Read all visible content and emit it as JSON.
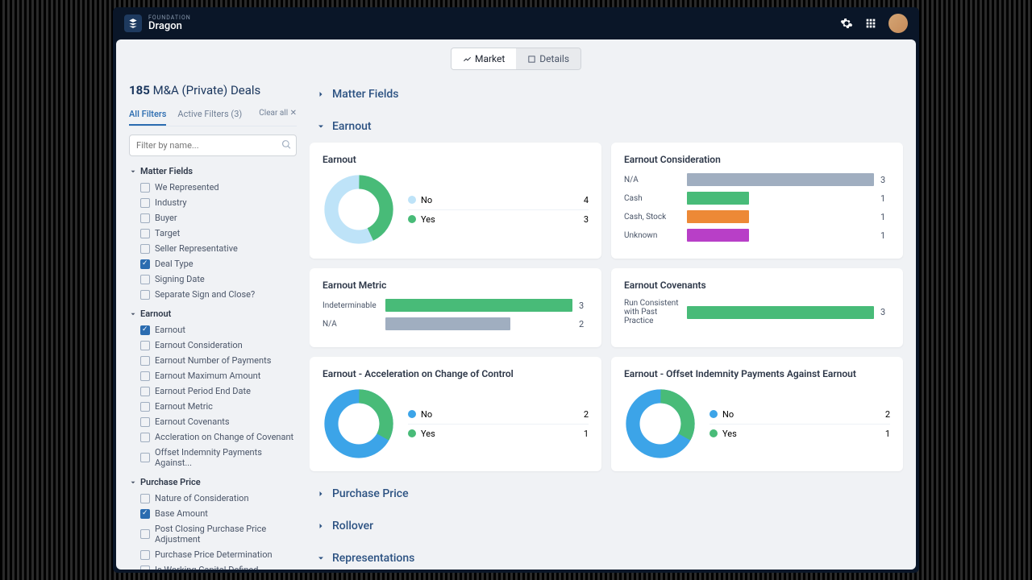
{
  "brand": {
    "sub": "FOUNDATION",
    "main": "Dragon"
  },
  "toggle": {
    "market": "Market",
    "details": "Details"
  },
  "sidebar": {
    "count": "185",
    "title": "M&A (Private) Deals",
    "tabs": {
      "all": "All Filters",
      "active": "Active Filters (3)",
      "clear": "Clear all"
    },
    "search_placeholder": "Filter by name...",
    "groups": [
      {
        "title": "Matter Fields",
        "items": [
          {
            "label": "We Represented",
            "checked": false
          },
          {
            "label": "Industry",
            "checked": false
          },
          {
            "label": "Buyer",
            "checked": false
          },
          {
            "label": "Target",
            "checked": false
          },
          {
            "label": "Seller Representative",
            "checked": false
          },
          {
            "label": "Deal Type",
            "checked": true
          },
          {
            "label": "Signing Date",
            "checked": false
          },
          {
            "label": "Separate Sign and Close?",
            "checked": false
          }
        ]
      },
      {
        "title": "Earnout",
        "items": [
          {
            "label": "Earnout",
            "checked": true
          },
          {
            "label": "Earnout Consideration",
            "checked": false
          },
          {
            "label": "Earnout Number of Payments",
            "checked": false
          },
          {
            "label": "Earnout Maximum Amount",
            "checked": false
          },
          {
            "label": "Earnout Period End Date",
            "checked": false
          },
          {
            "label": "Earnout Metric",
            "checked": false
          },
          {
            "label": "Earnout Covenants",
            "checked": false
          },
          {
            "label": "Accleration on Change of Covenant",
            "checked": false
          },
          {
            "label": "Offset Indemnity Payments Against...",
            "checked": false
          }
        ]
      },
      {
        "title": "Purchase Price",
        "items": [
          {
            "label": "Nature of Consideration",
            "checked": false
          },
          {
            "label": "Base Amount",
            "checked": true
          },
          {
            "label": "Post Closing Purchase Price Adjustment",
            "checked": false
          },
          {
            "label": "Purchase Price Determination",
            "checked": false
          },
          {
            "label": "Is Working Capital Defined",
            "checked": false
          }
        ]
      }
    ]
  },
  "sections": {
    "matter": "Matter Fields",
    "earnout": "Earnout",
    "purchase": "Purchase Price",
    "rollover": "Rollover",
    "reps": "Representations"
  },
  "cards": {
    "earnout": {
      "title": "Earnout",
      "legend": [
        {
          "label": "No",
          "val": 4,
          "color": "#bee3f8"
        },
        {
          "label": "Yes",
          "val": 3,
          "color": "#48bb78"
        }
      ]
    },
    "consideration": {
      "title": "Earnout Consideration",
      "bars": [
        {
          "label": "N/A",
          "val": 3,
          "max": 3,
          "color": "#a0aec0"
        },
        {
          "label": "Cash",
          "val": 1,
          "max": 3,
          "color": "#48bb78"
        },
        {
          "label": "Cash, Stock",
          "val": 1,
          "max": 3,
          "color": "#ed8936"
        },
        {
          "label": "Unknown",
          "val": 1,
          "max": 3,
          "color": "#b83fc7"
        }
      ]
    },
    "metric": {
      "title": "Earnout Metric",
      "bars": [
        {
          "label": "Indeterminable",
          "val": 3,
          "max": 3,
          "color": "#48bb78"
        },
        {
          "label": "N/A",
          "val": 2,
          "max": 3,
          "color": "#a0aec0"
        }
      ]
    },
    "covenants": {
      "title": "Earnout Covenants",
      "bars": [
        {
          "label": "Run Consistent with Past Practice",
          "val": 3,
          "max": 3,
          "color": "#48bb78"
        }
      ]
    },
    "accel": {
      "title": "Earnout - Acceleration on Change of Control",
      "legend": [
        {
          "label": "No",
          "val": 2,
          "color": "#3ca4e8"
        },
        {
          "label": "Yes",
          "val": 1,
          "color": "#48bb78"
        }
      ]
    },
    "offset": {
      "title": "Earnout - Offset Indemnity Payments Against Earnout",
      "legend": [
        {
          "label": "No",
          "val": 2,
          "color": "#3ca4e8"
        },
        {
          "label": "Yes",
          "val": 1,
          "color": "#48bb78"
        }
      ]
    }
  },
  "chart_data": [
    {
      "type": "pie",
      "title": "Earnout",
      "categories": [
        "No",
        "Yes"
      ],
      "values": [
        4,
        3
      ]
    },
    {
      "type": "bar",
      "title": "Earnout Consideration",
      "categories": [
        "N/A",
        "Cash",
        "Cash, Stock",
        "Unknown"
      ],
      "values": [
        3,
        1,
        1,
        1
      ]
    },
    {
      "type": "bar",
      "title": "Earnout Metric",
      "categories": [
        "Indeterminable",
        "N/A"
      ],
      "values": [
        3,
        2
      ]
    },
    {
      "type": "bar",
      "title": "Earnout Covenants",
      "categories": [
        "Run Consistent with Past Practice"
      ],
      "values": [
        3
      ]
    },
    {
      "type": "pie",
      "title": "Earnout - Acceleration on Change of Control",
      "categories": [
        "No",
        "Yes"
      ],
      "values": [
        2,
        1
      ]
    },
    {
      "type": "pie",
      "title": "Earnout - Offset Indemnity Payments Against Earnout",
      "categories": [
        "No",
        "Yes"
      ],
      "values": [
        2,
        1
      ]
    }
  ]
}
